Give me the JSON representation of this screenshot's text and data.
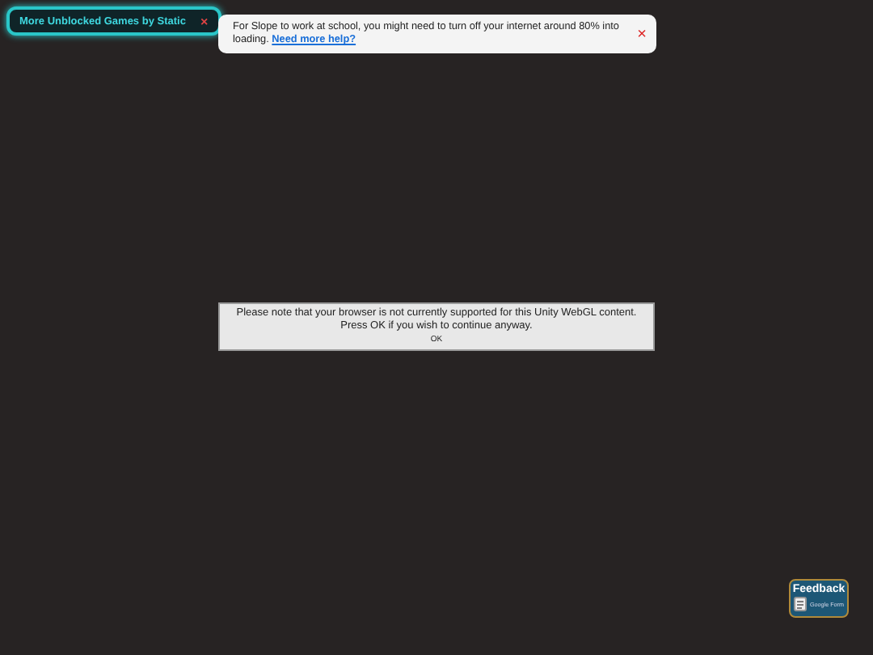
{
  "games_button": {
    "label": "More Unblocked Games by Static",
    "close": "×"
  },
  "notice": {
    "text": "For Slope to work at school, you might need to turn off your internet around 80% into loading.",
    "link": "Need more help?",
    "close": "×"
  },
  "dialog": {
    "lines": [
      "Please note that your browser is not currently supported for this Unity WebGL content.",
      "Press OK if you wish to continue anyway."
    ],
    "button": "OK"
  },
  "feedback": {
    "title": "Feedback",
    "subtitle": "Google Form"
  }
}
